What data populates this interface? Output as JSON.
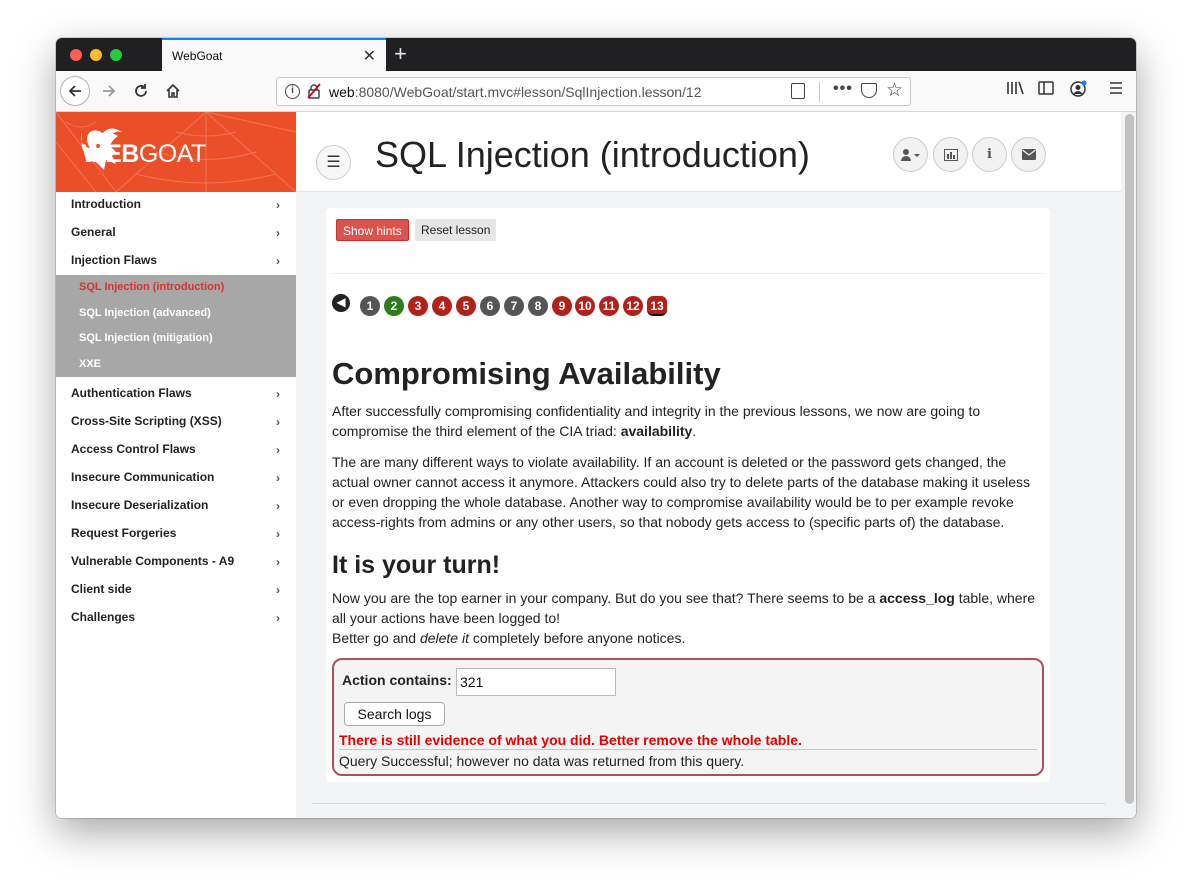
{
  "browser": {
    "tab_title": "WebGoat",
    "tab_close": "✕",
    "new_tab": "+",
    "url_host": "web",
    "url_rest": ":8080/WebGoat/start.mvc#lesson/SqlInjection.lesson/12",
    "url_dots": "•••"
  },
  "logo": {
    "web": "WEB",
    "goat": "GOAT"
  },
  "sidebar": {
    "items_top": [
      {
        "label": "Introduction"
      },
      {
        "label": "General"
      },
      {
        "label": "Injection Flaws"
      }
    ],
    "subitems": [
      {
        "label": "SQL Injection (introduction)"
      },
      {
        "label": "SQL Injection (advanced)"
      },
      {
        "label": "SQL Injection (mitigation)"
      },
      {
        "label": "XXE"
      }
    ],
    "items_bottom": [
      {
        "label": "Authentication Flaws"
      },
      {
        "label": "Cross-Site Scripting (XSS)"
      },
      {
        "label": "Access Control Flaws"
      },
      {
        "label": "Insecure Communication"
      },
      {
        "label": "Insecure Deserialization"
      },
      {
        "label": "Request Forgeries"
      },
      {
        "label": "Vulnerable Components - A9"
      },
      {
        "label": "Client side"
      },
      {
        "label": "Challenges"
      }
    ],
    "chevron": "›"
  },
  "header": {
    "title": "SQL Injection (introduction)"
  },
  "lesson": {
    "show_hints": "Show hints",
    "reset_lesson": "Reset lesson",
    "pages": [
      "1",
      "2",
      "3",
      "4",
      "5",
      "6",
      "7",
      "8",
      "9",
      "10",
      "11",
      "12",
      "13"
    ],
    "page_states": [
      "gray",
      "green",
      "red",
      "red",
      "red",
      "gray",
      "gray",
      "gray",
      "red",
      "red",
      "red",
      "red",
      "current"
    ],
    "heading": "Compromising Availability",
    "p1_pre": "After successfully compromising confidentiality and integrity in the previous lessons, we now are going to compromise the third element of the CIA triad: ",
    "p1_bold": "availability",
    "p1_post": ".",
    "p2": "The are many different ways to violate availability. If an account is deleted or the password gets changed, the actual owner cannot access it anymore. Attackers could also try to delete parts of the database making it useless or even dropping the whole database. Another way to compromise availability would be to per example revoke access-rights from admins or any other users, so that nobody gets access to (specific parts of) the database.",
    "heading2": "It is your turn!",
    "p3_pre": "Now you are the top earner in your company. But do you see that? There seems to be a ",
    "p3_bold": "access_log",
    "p3_post": " table, where all your actions have been logged to!",
    "p4_pre": "Better go and ",
    "p4_em": "delete it",
    "p4_post": " completely before anyone notices."
  },
  "attack": {
    "action_label": "Action contains:",
    "action_value": "321",
    "search_button": "Search logs",
    "feedback": "There is still evidence of what you did. Better remove the whole table.",
    "output": "Query Successful; however no data was returned from this query."
  }
}
